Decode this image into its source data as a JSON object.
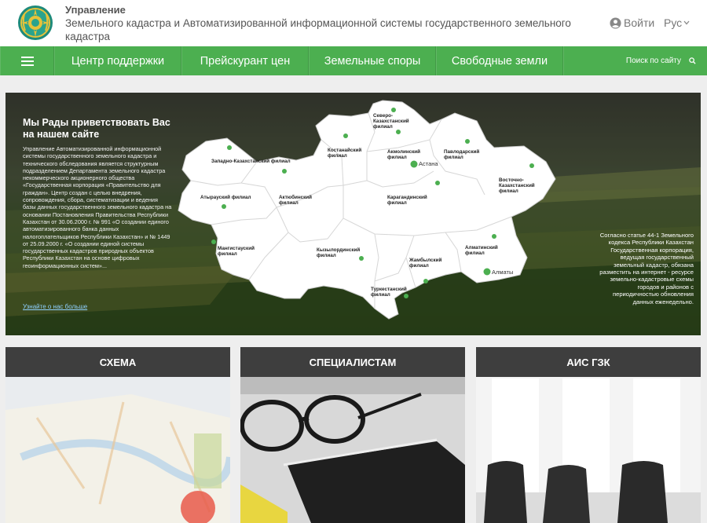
{
  "header": {
    "title": "Управление",
    "subtitle": "Земельного кадастра и Автоматизированной информационной системы государственного земельного кадастра",
    "login_label": "Войти",
    "lang_label": "Рус"
  },
  "nav": {
    "items": [
      {
        "label": "Центр поддержки"
      },
      {
        "label": "Прейскурант цен"
      },
      {
        "label": "Земельные споры"
      },
      {
        "label": "Свободные земли"
      }
    ],
    "search_label": "Поиск по сайту"
  },
  "hero": {
    "welcome_title": "Мы Рады приветствовать Вас на нашем сайте",
    "welcome_text": "Управление Автоматизированной информационной системы государственного земельного кадастра и технического обследования является структурным подразделением Департамента земельного кадастра некоммерческого акционерного общества «Государственная корпорация «Правительство для граждан». Центр создан с целью внедрения, сопровождения, сбора, систематизации и ведения базы данных государственного земельного кадастра на основании Постановления Правительства Республики Казахстан от 30.06.2000 г. № 991 «О создании единого автоматизированного банка данных налогоплательщиков Республики Казахстан» и № 1449 от 25.09.2000 г. «О создании единой системы государственных кадастров природных объектов Республики Казахстан на основе цифровых геоинформационных систем»...",
    "more_link": "Узнайте о нас больше",
    "law_text": "Согласно статье 44-1 Земельного кодекса Республики Казахстан Государственная корпорация, ведущая государственный земельный кадастр, обязана разместить на интернет - ресурсе земельно-кадастровые схемы городов и районов с периодичностью обновления данных еженедельно."
  },
  "map": {
    "regions": [
      {
        "label": "Западно-Казахстанский филиал"
      },
      {
        "label": "Атырауский филиал"
      },
      {
        "label": "Мангистауский филиал"
      },
      {
        "label": "Актюбинский филиал"
      },
      {
        "label": "Костанайский филиал"
      },
      {
        "label": "Северо-Казахстанский филиал"
      },
      {
        "label": "Акмолинский филиал"
      },
      {
        "label": "Павлодарский филиал"
      },
      {
        "label": "Карагандинский филиал"
      },
      {
        "label": "Восточно-Казахстанский филиал"
      },
      {
        "label": "Кызылординский филиал"
      },
      {
        "label": "Жамбылский филиал"
      },
      {
        "label": "Алматинский филиал"
      },
      {
        "label": "Туркестанский филиал"
      }
    ],
    "cities": [
      {
        "label": "Астана"
      },
      {
        "label": "Алматы"
      }
    ],
    "marker_color": "#4caf50"
  },
  "cards": [
    {
      "label": "СХЕМА"
    },
    {
      "label": "СПЕЦИАЛИСТАМ"
    },
    {
      "label": "АИС ГЗК"
    }
  ],
  "colors": {
    "nav": "#4caf50",
    "card_header": "#3e3e3e"
  }
}
